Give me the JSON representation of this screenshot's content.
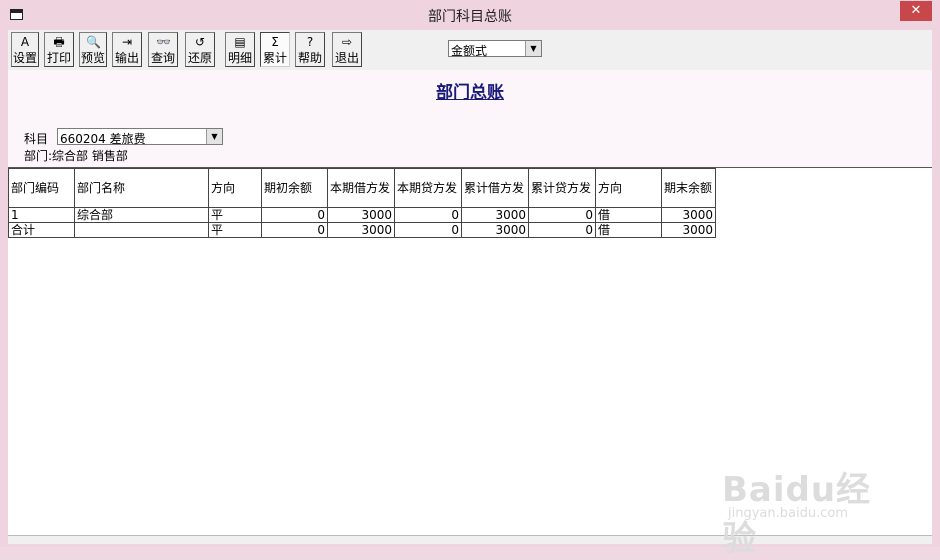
{
  "window": {
    "title": "部门科目总账",
    "close_label": "✕"
  },
  "toolbar": {
    "buttons": [
      {
        "label": "设置",
        "icon": "settings-icon",
        "glyph": "A"
      },
      {
        "label": "打印",
        "icon": "print-icon",
        "glyph": "🖶"
      },
      {
        "label": "预览",
        "icon": "preview-icon",
        "glyph": "🔍"
      },
      {
        "label": "输出",
        "icon": "export-icon",
        "glyph": "⇥"
      },
      {
        "label": "查询",
        "icon": "binoculars-icon",
        "glyph": "👓"
      },
      {
        "label": "还原",
        "icon": "restore-icon",
        "glyph": "↺"
      },
      {
        "label": "明细",
        "icon": "detail-icon",
        "glyph": "▤"
      },
      {
        "label": "累计",
        "icon": "sigma-icon",
        "glyph": "Σ"
      },
      {
        "label": "帮助",
        "icon": "help-icon",
        "glyph": "?"
      },
      {
        "label": "退出",
        "icon": "exit-icon",
        "glyph": "⇨"
      }
    ],
    "mode_select": "金额式"
  },
  "report": {
    "title": "部门总账",
    "subject_label": "科目",
    "subject_value": "660204 差旅费",
    "dept_label": "部门:",
    "dept_value": "综合部 销售部"
  },
  "table": {
    "headers": [
      "部门编码",
      "部门名称",
      "方向",
      "期初余额",
      "本期借方发",
      "本期贷方发",
      "累计借方发",
      "累计贷方发",
      "方向",
      "期末余额"
    ],
    "rows": [
      [
        "1",
        "综合部",
        "平",
        "0",
        "3000",
        "0",
        "3000",
        "0",
        "借",
        "3000"
      ],
      [
        "合计",
        "",
        "平",
        "0",
        "3000",
        "0",
        "3000",
        "0",
        "借",
        "3000"
      ]
    ]
  },
  "watermark": {
    "brand": "Baidu经验",
    "url": "jingyan.baidu.com"
  }
}
